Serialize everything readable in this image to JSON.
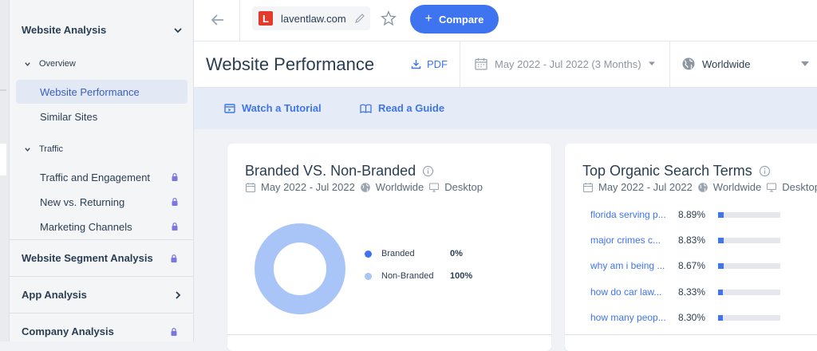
{
  "sidebar": {
    "website_analysis": "Website Analysis",
    "overview": "Overview",
    "overview_items": [
      "Website Performance",
      "Similar Sites"
    ],
    "traffic": "Traffic",
    "traffic_items": [
      "Traffic and Engagement",
      "New vs. Returning",
      "Marketing Channels"
    ],
    "website_segment": "Website Segment Analysis",
    "app_analysis": "App Analysis",
    "company_analysis": "Company Analysis"
  },
  "topbar": {
    "site": "laventlaw.com",
    "favicon_letter": "L",
    "compare_label": "Compare"
  },
  "header": {
    "title": "Website Performance",
    "pdf_label": "PDF",
    "date_range": "May 2022 - Jul 2022 (3 Months)",
    "geo": "Worldwide"
  },
  "links": {
    "tutorial": "Watch a Tutorial",
    "guide": "Read a Guide"
  },
  "branded_card": {
    "title": "Branded VS. Non-Branded",
    "date": "May 2022 - Jul 2022",
    "geo": "Worldwide",
    "device": "Desktop",
    "legend": [
      {
        "label": "Branded",
        "value": "0%",
        "color": "#3e74f0"
      },
      {
        "label": "Non-Branded",
        "value": "100%",
        "color": "#a9c4f7"
      }
    ]
  },
  "organic_card": {
    "title": "Top Organic Search Terms",
    "date": "May 2022 - Jul 2022",
    "geo": "Worldwide",
    "device": "Desktop",
    "terms": [
      {
        "term": "florida serving p...",
        "pct": "8.89%",
        "share": 0.0889
      },
      {
        "term": "major crimes c...",
        "pct": "8.83%",
        "share": 0.0883
      },
      {
        "term": "why am i being ...",
        "pct": "8.67%",
        "share": 0.0867
      },
      {
        "term": "how do car law...",
        "pct": "8.33%",
        "share": 0.0833
      },
      {
        "term": "how many peop...",
        "pct": "8.30%",
        "share": 0.083
      }
    ]
  },
  "colors": {
    "accent": "#3e74f0",
    "donut": "#a9c4f7"
  }
}
